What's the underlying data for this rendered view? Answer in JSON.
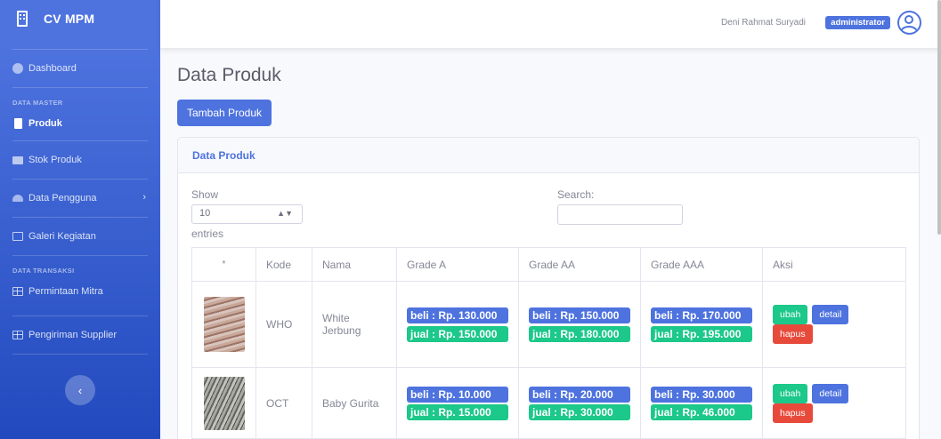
{
  "brand": {
    "name": "CV MPM"
  },
  "sidebar": {
    "dashboard": "Dashboard",
    "section_master": "DATA MASTER",
    "produk": "Produk",
    "stok": "Stok Produk",
    "pengguna": "Data Pengguna",
    "galeri": "Galeri Kegiatan",
    "section_transaksi": "DATA TRANSAKSI",
    "permintaan": "Permintaan Mitra",
    "pengiriman": "Pengiriman Supplier"
  },
  "topbar": {
    "user_name": "Deni Rahmat Suryadi",
    "role": "administrator"
  },
  "main": {
    "title": "Data Produk",
    "add_button": "Tambah Produk",
    "card_title": "Data Produk",
    "show_label": "Show",
    "entries_value": "10",
    "entries_label": "entries",
    "search_label": "Search:"
  },
  "table": {
    "headers": [
      "*",
      "Kode",
      "Nama",
      "Grade A",
      "Grade AA",
      "Grade AAA",
      "Aksi"
    ],
    "rows": [
      {
        "kode": "WHO",
        "nama": "White Jerbung",
        "a_beli": "beli : Rp. 130.000",
        "a_jual": "jual : Rp. 150.000",
        "aa_beli": "beli : Rp. 150.000",
        "aa_jual": "jual : Rp. 180.000",
        "aaa_beli": "beli : Rp. 170.000",
        "aaa_jual": "jual : Rp. 195.000"
      },
      {
        "kode": "OCT",
        "nama": "Baby Gurita",
        "a_beli": "beli : Rp. 10.000",
        "a_jual": "jual : Rp. 15.000",
        "aa_beli": "beli : Rp. 20.000",
        "aa_jual": "jual : Rp. 30.000",
        "aaa_beli": "beli : Rp. 30.000",
        "aaa_jual": "jual : Rp. 46.000"
      }
    ],
    "actions": {
      "edit": "ubah",
      "detail": "detail",
      "delete": "hapus"
    }
  },
  "colors": {
    "primary": "#4e73df",
    "success": "#1cc88a",
    "danger": "#e74a3b"
  }
}
